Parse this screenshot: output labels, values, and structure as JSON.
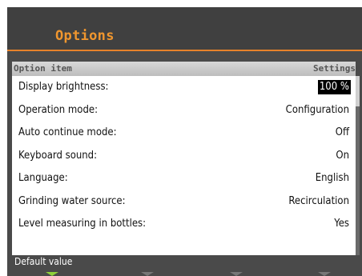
{
  "title": "Options",
  "table": {
    "col_left": "Option item",
    "col_right": "Settings",
    "rows": [
      {
        "label": "Display brightness:",
        "value": "100 %"
      },
      {
        "label": "Operation mode:",
        "value": "Configuration"
      },
      {
        "label": "Auto continue mode:",
        "value": "Off"
      },
      {
        "label": "Keyboard sound:",
        "value": "On"
      },
      {
        "label": "Language:",
        "value": "English"
      },
      {
        "label": "Grinding water source:",
        "value": "Recirculation"
      },
      {
        "label": "Level measuring in bottles:",
        "value": "Yes"
      }
    ]
  },
  "footer": {
    "hint": "Default value"
  },
  "colors": {
    "accent": "#e8822a",
    "title": "#f0962e",
    "softkey_active": "#8fd13a"
  },
  "icons": [
    "softkey-arrow-icon"
  ]
}
